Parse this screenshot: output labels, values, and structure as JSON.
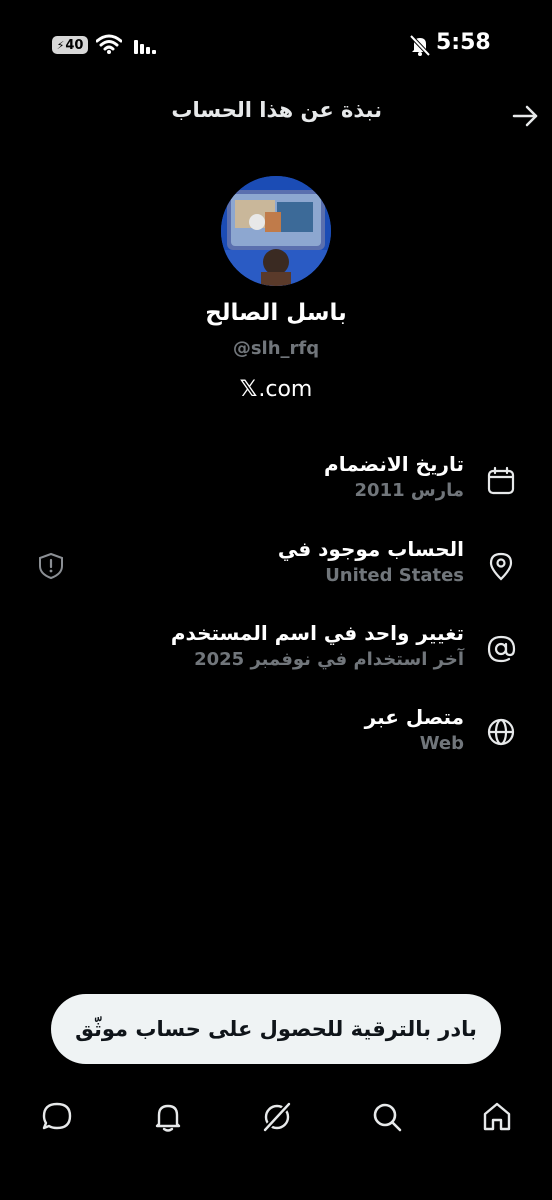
{
  "status_bar": {
    "battery": "40",
    "time": "5:58"
  },
  "header": {
    "title": "نبذة عن هذا الحساب"
  },
  "profile": {
    "name": "باسل الصالح",
    "handle": "@slh_rfq",
    "website_domain": ".com",
    "website_logo": "𝕏"
  },
  "info_rows": [
    {
      "title": "تاريخ الانضمام",
      "value": "مارس 2011",
      "icon": "calendar-icon"
    },
    {
      "title": "الحساب موجود في",
      "value": "United States",
      "icon": "location-pin-icon"
    },
    {
      "title": "تغيير واحد في اسم المستخدم",
      "value": "آخر استخدام في نوفمبر 2025",
      "icon": "at-sign-icon"
    },
    {
      "title": "متصل عبر",
      "value": "Web",
      "icon": "globe-icon"
    }
  ],
  "upgrade": {
    "label": "بادر بالترقية للحصول على حساب موثّق"
  },
  "colors": {
    "background": "#000000",
    "primary_text": "#e7e9ea",
    "secondary_text": "#71767b",
    "button_bg": "#eff3f4"
  }
}
